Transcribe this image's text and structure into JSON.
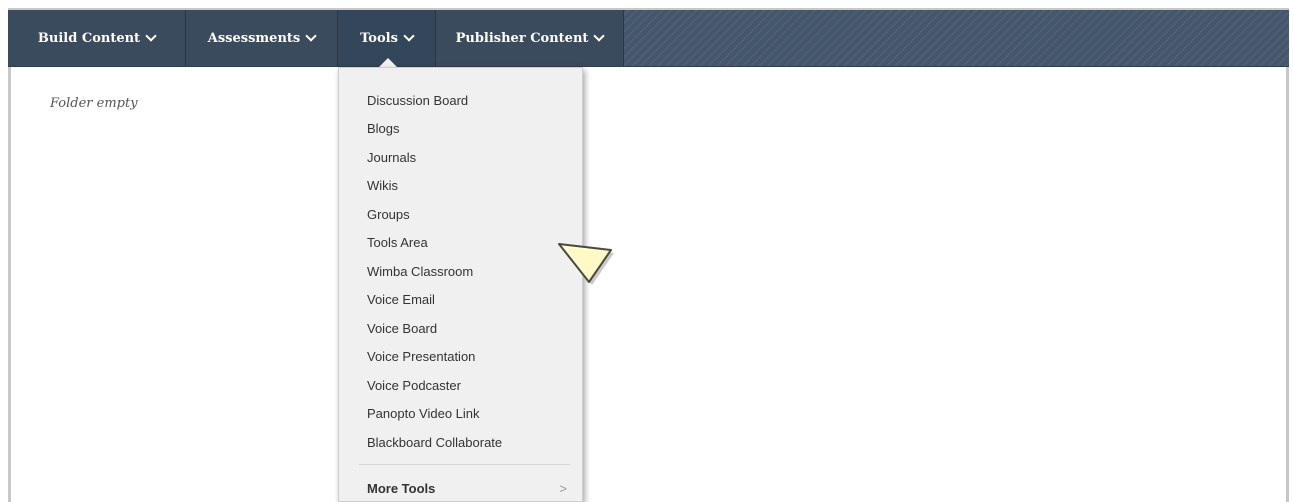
{
  "menubar": {
    "items": [
      {
        "label": "Build Content"
      },
      {
        "label": "Assessments"
      },
      {
        "label": "Tools",
        "active": true
      },
      {
        "label": "Publisher Content"
      }
    ],
    "color": "#44566b"
  },
  "content": {
    "empty_text": "Folder empty"
  },
  "tools_menu": {
    "items": [
      "Discussion Board",
      "Blogs",
      "Journals",
      "Wikis",
      "Groups",
      "Tools Area",
      "Wimba Classroom",
      "Voice Email",
      "Voice Board",
      "Voice Presentation",
      "Voice Podcaster",
      "Panopto Video Link",
      "Blackboard Collaborate"
    ],
    "more": {
      "label": "More Tools",
      "arrow": ">"
    }
  },
  "pointer": {
    "icon": "arrow-pointer-icon",
    "color": "#fff9c4"
  }
}
